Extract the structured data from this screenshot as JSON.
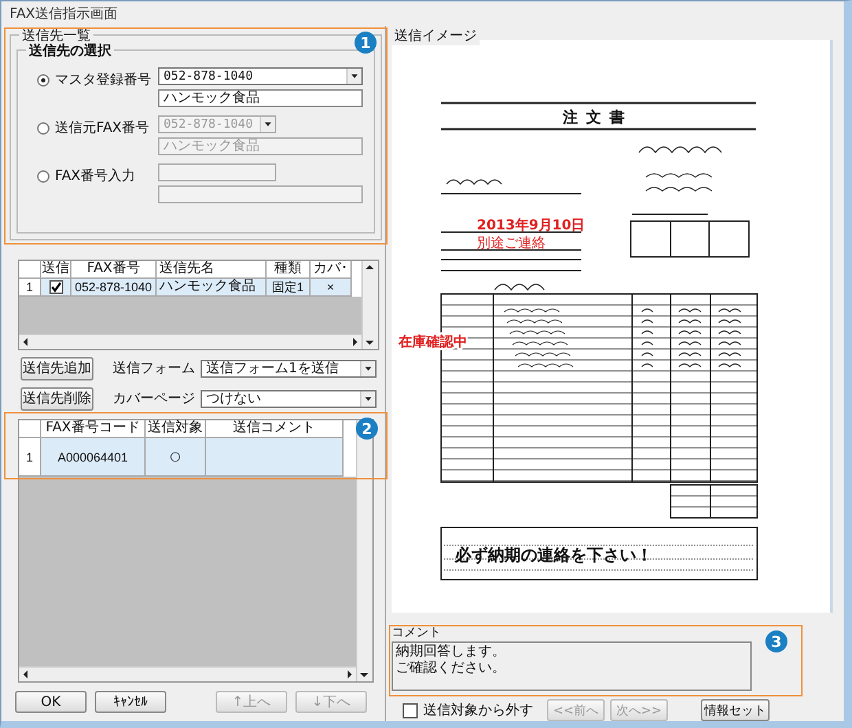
{
  "window": {
    "title": "FAX送信指示画面"
  },
  "recipients_group": {
    "title": "送信先一覧",
    "selection_title": "送信先の選択",
    "options": [
      {
        "label": "マスタ登録番号",
        "selected": true,
        "disabled": false,
        "kind": "combo",
        "number": "052-878-1040",
        "name": "ハンモック食品"
      },
      {
        "label": "送信元FAX番号",
        "selected": false,
        "disabled": true,
        "kind": "combo",
        "number": "052-878-1040",
        "name": "ハンモック食品"
      },
      {
        "label": "FAX番号入力",
        "selected": false,
        "disabled": true,
        "kind": "input"
      }
    ]
  },
  "recipients_table": {
    "columns": [
      "送信",
      "FAX番号",
      "送信先名",
      "種類",
      "カバ･"
    ],
    "rows": [
      {
        "index": "1",
        "send": true,
        "fax": "052-878-1040",
        "name": "ハンモック食品",
        "type": "固定1",
        "cover": "×",
        "selected": true
      }
    ]
  },
  "add_button": "送信先追加",
  "remove_button": "送信先削除",
  "form": {
    "label": "送信フォーム",
    "value": "送信フォーム1を送信"
  },
  "cover_page": {
    "label": "カバーページ",
    "value": "つけない"
  },
  "documents_table": {
    "columns": [
      "FAX番号コード",
      "送信対象",
      "送信コメント"
    ],
    "rows": [
      {
        "index": "1",
        "code": "A000064401",
        "target": "○",
        "selected": true
      }
    ]
  },
  "left_buttons": [
    {
      "label": "OK",
      "disabled": false
    },
    {
      "label": "ｷｬﾝｾﾙ",
      "disabled": false
    },
    {
      "label": "↑上へ",
      "disabled": true
    },
    {
      "label": "↓下へ",
      "disabled": true
    }
  ],
  "preview": {
    "title": "送信イメージ",
    "document_title": "注文書",
    "delivery_date": "2013年9月10日",
    "delivery_place": "別途ご連絡",
    "stock_note": "在庫確認中",
    "remark": "必ず納期の連絡を下さい！"
  },
  "comment": {
    "label": "コメント",
    "lines": [
      "納期回答します。",
      "ご確認ください。"
    ]
  },
  "exclude_checkbox": {
    "label": "送信対象から外す",
    "checked": false
  },
  "right_buttons": [
    {
      "label": "<<前へ",
      "disabled": true
    },
    {
      "label": "次へ>>",
      "disabled": true
    },
    {
      "label": "情報セット",
      "disabled": false
    }
  ],
  "callouts": [
    {
      "number": "1"
    },
    {
      "number": "2"
    },
    {
      "number": "3"
    }
  ]
}
